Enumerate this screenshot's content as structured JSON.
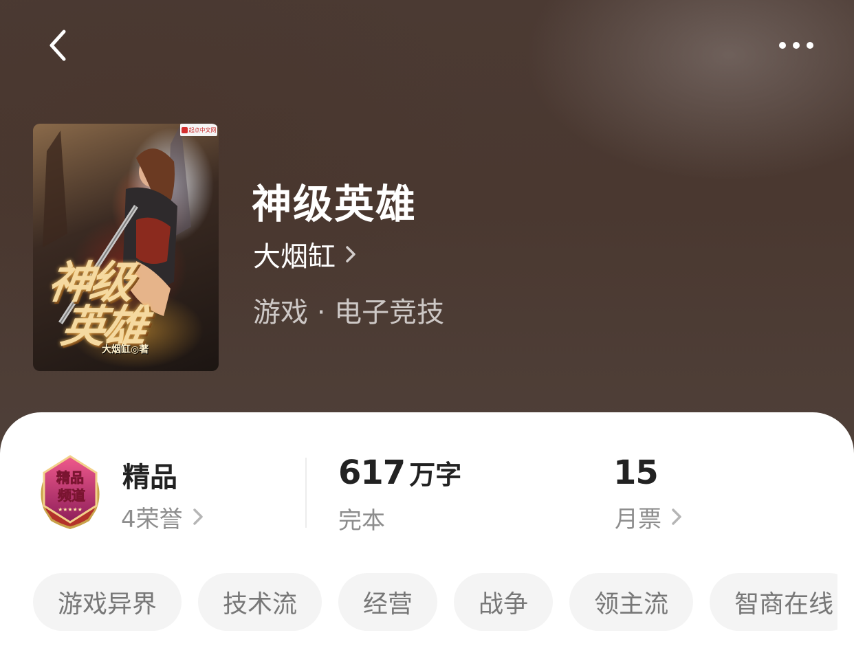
{
  "book": {
    "title": "神级英雄",
    "author": "大烟缸",
    "category": "游戏 · 电子竞技"
  },
  "cover": {
    "title_line1": "神级",
    "title_line2": "英雄",
    "author_credit": "大烟缸◎著",
    "publisher_badge": "起点中文网"
  },
  "stats": {
    "honor": {
      "title": "精品",
      "link": "4荣誉",
      "badge_text_1": "精品",
      "badge_text_2": "频道"
    },
    "words": {
      "number": "617",
      "unit": "万字",
      "status": "完本"
    },
    "tickets": {
      "number": "15",
      "label": "月票"
    }
  },
  "tags": [
    "游戏异界",
    "技术流",
    "经营",
    "战争",
    "领主流",
    "智商在线"
  ],
  "icons": {
    "back": "back-arrow-icon",
    "more": "more-dots-icon",
    "chevron": "chevron-right-icon"
  },
  "colors": {
    "hero_bg": "#4a3830",
    "text_white": "#ffffff",
    "text_dark": "#222222",
    "text_muted": "#8d8d8d",
    "tag_bg": "#f4f4f4"
  }
}
